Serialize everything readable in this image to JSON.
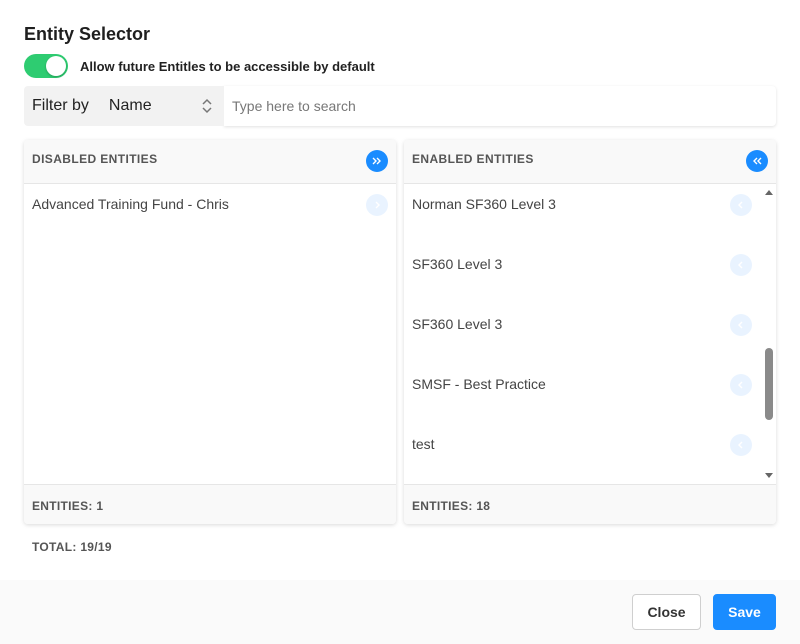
{
  "dialog": {
    "title": "Entity Selector",
    "toggle_label": "Allow future Entitles to be accessible by default",
    "toggle_on": true
  },
  "filter": {
    "label": "Filter by",
    "selected": "Name",
    "search_placeholder": "Type here to search"
  },
  "disabled_panel": {
    "heading": "DISABLED ENTITIES",
    "items": [
      "Advanced Training Fund - Chris"
    ],
    "count_label": "ENTITIES: 1"
  },
  "enabled_panel": {
    "heading": "ENABLED ENTITIES",
    "items": [
      "Norman SF360 Level 3",
      "SF360 Level 3",
      "SF360 Level 3",
      "SMSF - Best Practice",
      "test"
    ],
    "count_label": "ENTITIES: 18"
  },
  "total_label": "TOTAL: 19/19",
  "footer": {
    "close_label": "Close",
    "save_label": "Save"
  },
  "colors": {
    "accent": "#1a8cff",
    "toggle": "#2ecc71"
  }
}
